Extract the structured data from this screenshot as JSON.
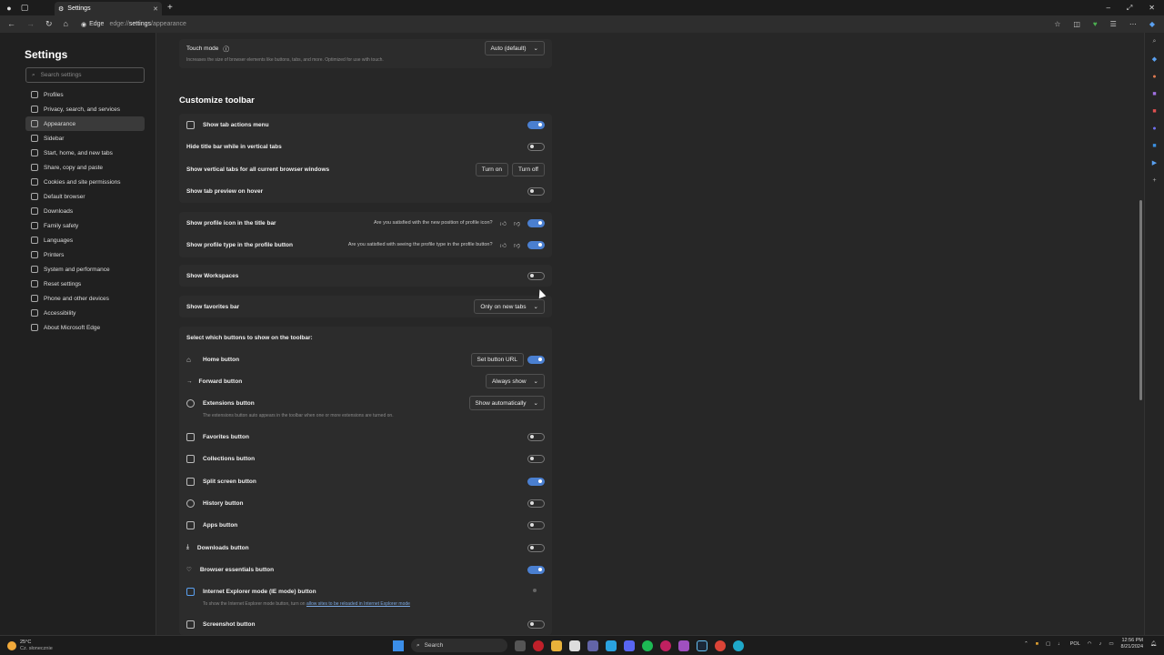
{
  "window": {
    "tab_title": "Settings",
    "new_tab_glyph": "+",
    "win_min": "–",
    "win_max": "⤢",
    "win_close": "✕"
  },
  "address": {
    "site": "Edge",
    "url_prefix": "edge://",
    "url_bold": "settings",
    "url_rest": "/appearance"
  },
  "left_nav": {
    "title": "Settings",
    "search_placeholder": "Search settings",
    "items": [
      {
        "label": "Profiles"
      },
      {
        "label": "Privacy, search, and services"
      },
      {
        "label": "Appearance"
      },
      {
        "label": "Sidebar"
      },
      {
        "label": "Start, home, and new tabs"
      },
      {
        "label": "Share, copy and paste"
      },
      {
        "label": "Cookies and site permissions"
      },
      {
        "label": "Default browser"
      },
      {
        "label": "Downloads"
      },
      {
        "label": "Family safety"
      },
      {
        "label": "Languages"
      },
      {
        "label": "Printers"
      },
      {
        "label": "System and performance"
      },
      {
        "label": "Reset settings"
      },
      {
        "label": "Phone and other devices"
      },
      {
        "label": "Accessibility"
      },
      {
        "label": "About Microsoft Edge"
      }
    ],
    "active_index": 2
  },
  "touch_mode": {
    "label": "Touch mode",
    "description": "Increases the size of browser elements like buttons, tabs, and more. Optimized for use with touch.",
    "value": "Auto (default)"
  },
  "customize_toolbar": {
    "title": "Customize toolbar",
    "show_tab_actions": "Show tab actions menu",
    "hide_title_bar": "Hide title bar while in vertical tabs",
    "vertical_tabs_all": "Show vertical tabs for all current browser windows",
    "turn_on": "Turn on",
    "turn_off": "Turn off",
    "tab_preview": "Show tab preview on hover",
    "profile_icon": "Show profile icon in the title bar",
    "profile_icon_q": "Are you satisfied with the new position of profile icon?",
    "profile_type": "Show profile type in the profile button",
    "profile_type_q": "Are you satisfied with seeing the profile type in the profile button?",
    "workspaces": "Show Workspaces",
    "favorites_bar": "Show favorites bar",
    "favorites_bar_value": "Only on new tabs",
    "select_buttons": "Select which buttons to show on the toolbar:",
    "home_button": "Home button",
    "set_button_url": "Set button URL",
    "forward_button": "Forward button",
    "forward_value": "Always show",
    "extensions_button": "Extensions button",
    "extensions_value": "Show automatically",
    "extensions_desc": "The extensions button auto appears in the toolbar when one or more extensions are turned on.",
    "favorites_button": "Favorites button",
    "collections_button": "Collections button",
    "split_screen_button": "Split screen button",
    "history_button": "History button",
    "apps_button": "Apps button",
    "downloads_button": "Downloads button",
    "browser_essentials_button": "Browser essentials button",
    "ie_mode_button": "Internet Explorer mode (IE mode) button",
    "ie_desc_prefix": "To show the Internet Explorer mode button, turn on",
    "ie_desc_link": "allow sites to be reloaded in Internet Explorer mode",
    "screenshot_button": "Screenshot button"
  },
  "taskbar": {
    "temp": "25°C",
    "weather": "Cz. słonecznie",
    "search": "Search",
    "lang": "POL",
    "time": "12:56 PM",
    "date": "8/21/2024"
  },
  "colors": {
    "accent": "#4a7fd0"
  }
}
